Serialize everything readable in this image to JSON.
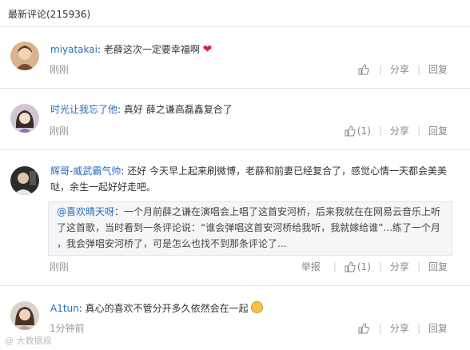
{
  "header": {
    "title": "最新评论(215936)"
  },
  "comments": [
    {
      "user": "miyatakai",
      "text": "老薛这次一定要幸福啊",
      "emoji": "heart",
      "time": "刚刚",
      "like_count": "",
      "share_label": "分享",
      "reply_label": "回复"
    },
    {
      "user": "时光让我忘了他",
      "text": "真好 薛之谦高磊鑫复合了",
      "time": "刚刚",
      "like_count": "(1)",
      "share_label": "分享",
      "reply_label": "回复"
    },
    {
      "user": "辉哥-威武霸气帅",
      "text_line1": "还好 今天早上起来刷微博，老薛和前妻已经复合了，感觉心情一天都会美美",
      "text_line2": "哒，余生一起好好走吧。",
      "quote": {
        "user": "@喜欢晴天呀",
        "line1": "一个月前薛之谦在演唱会上唱了这首安河桥，后来我就在在网易云音乐上听",
        "line2": "了这首歌，当时看到一条评论说：“谁会弹唱这首安河桥给我听，我就嫁给谁”...练了一个月",
        "line3": "，我会弹唱安河桥了，可是怎么也找不到那条评论了..."
      },
      "time": "刚刚",
      "report_label": "举报",
      "like_count": "(1)",
      "share_label": "分享",
      "reply_label": "回复"
    },
    {
      "user": "A1tun",
      "text": "真心的喜欢不管分开多久依然会在一起",
      "emoji": "smiley",
      "time": "1分钟前",
      "like_count": "",
      "share_label": "分享",
      "reply_label": "回复"
    }
  ],
  "watermark": "@ 大数据观",
  "colors": {
    "username": "#2a6dbd",
    "meta": "#999999"
  }
}
